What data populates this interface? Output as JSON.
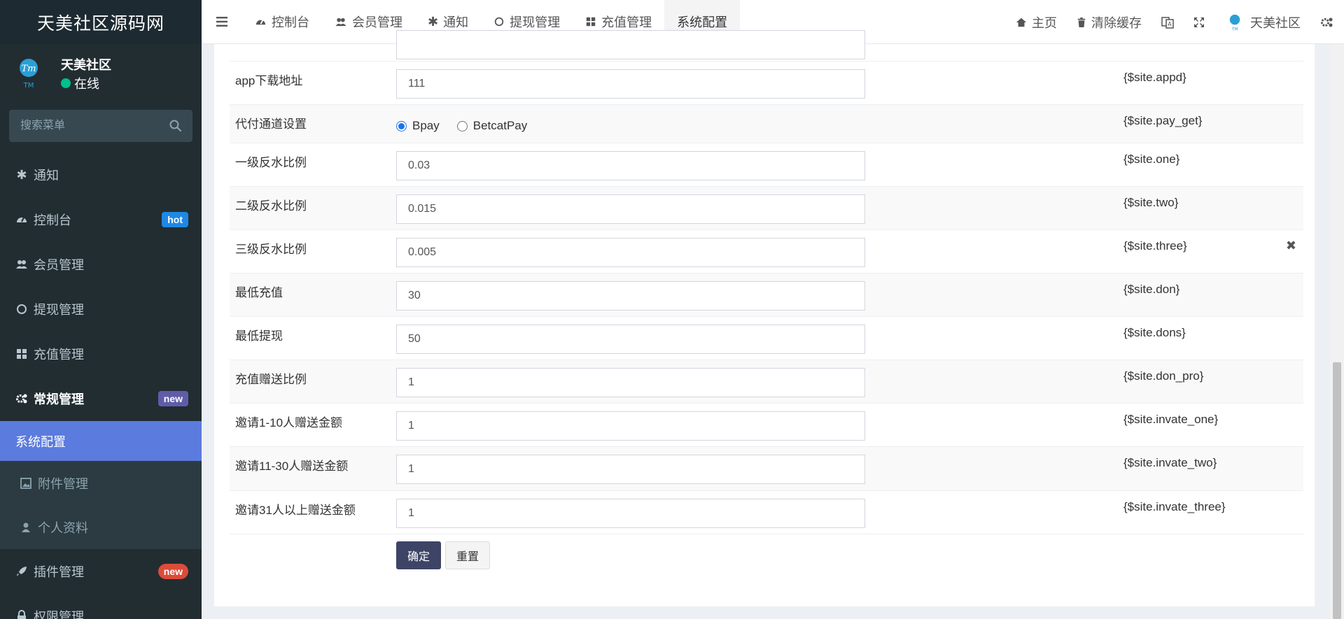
{
  "sidebar": {
    "logo": "天美社区源码网",
    "user_name": "天美社区",
    "user_status": "在线",
    "search_placeholder": "搜索菜单",
    "items": [
      {
        "label": "通知"
      },
      {
        "label": "控制台",
        "badge": "hot"
      },
      {
        "label": "会员管理"
      },
      {
        "label": "提现管理"
      },
      {
        "label": "充值管理"
      },
      {
        "label": "常规管理",
        "badge": "new"
      },
      {
        "label": "系统配置"
      },
      {
        "label": "附件管理"
      },
      {
        "label": "个人资料"
      },
      {
        "label": "插件管理",
        "badge": "new"
      },
      {
        "label": "权限管理"
      }
    ]
  },
  "topbar": {
    "tabs": [
      {
        "label": "控制台"
      },
      {
        "label": "会员管理"
      },
      {
        "label": "通知"
      },
      {
        "label": "提现管理"
      },
      {
        "label": "充值管理"
      },
      {
        "label": "系统配置"
      }
    ],
    "home": "主页",
    "clear_cache": "清除缓存",
    "user": "天美社区"
  },
  "form": {
    "rows": [
      {
        "label": "app下载地址",
        "value": "111",
        "var": "{$site.appd}"
      },
      {
        "label": "代付通道设置",
        "var": "{$site.pay_get}",
        "options": [
          "Bpay",
          "BetcatPay"
        ],
        "selected": "Bpay"
      },
      {
        "label": "一级反水比例",
        "value": "0.03",
        "var": "{$site.one}"
      },
      {
        "label": "二级反水比例",
        "value": "0.015",
        "var": "{$site.two}"
      },
      {
        "label": "三级反水比例",
        "value": "0.005",
        "var": "{$site.three}"
      },
      {
        "label": "最低充值",
        "value": "30",
        "var": "{$site.don}"
      },
      {
        "label": "最低提现",
        "value": "50",
        "var": "{$site.dons}"
      },
      {
        "label": "充值赠送比例",
        "value": "1",
        "var": "{$site.don_pro}"
      },
      {
        "label": "邀请1-10人赠送金额",
        "value": "1",
        "var": "{$site.invate_one}"
      },
      {
        "label": "邀请11-30人赠送金额",
        "value": "1",
        "var": "{$site.invate_two}"
      },
      {
        "label": "邀请31人以上赠送金额",
        "value": "1",
        "var": "{$site.invate_three}"
      }
    ],
    "submit": "确定",
    "reset": "重置"
  },
  "colors": {
    "sidebar_bg": "#222d32",
    "active": "#5b7bde",
    "primary_btn": "#3d4466"
  }
}
